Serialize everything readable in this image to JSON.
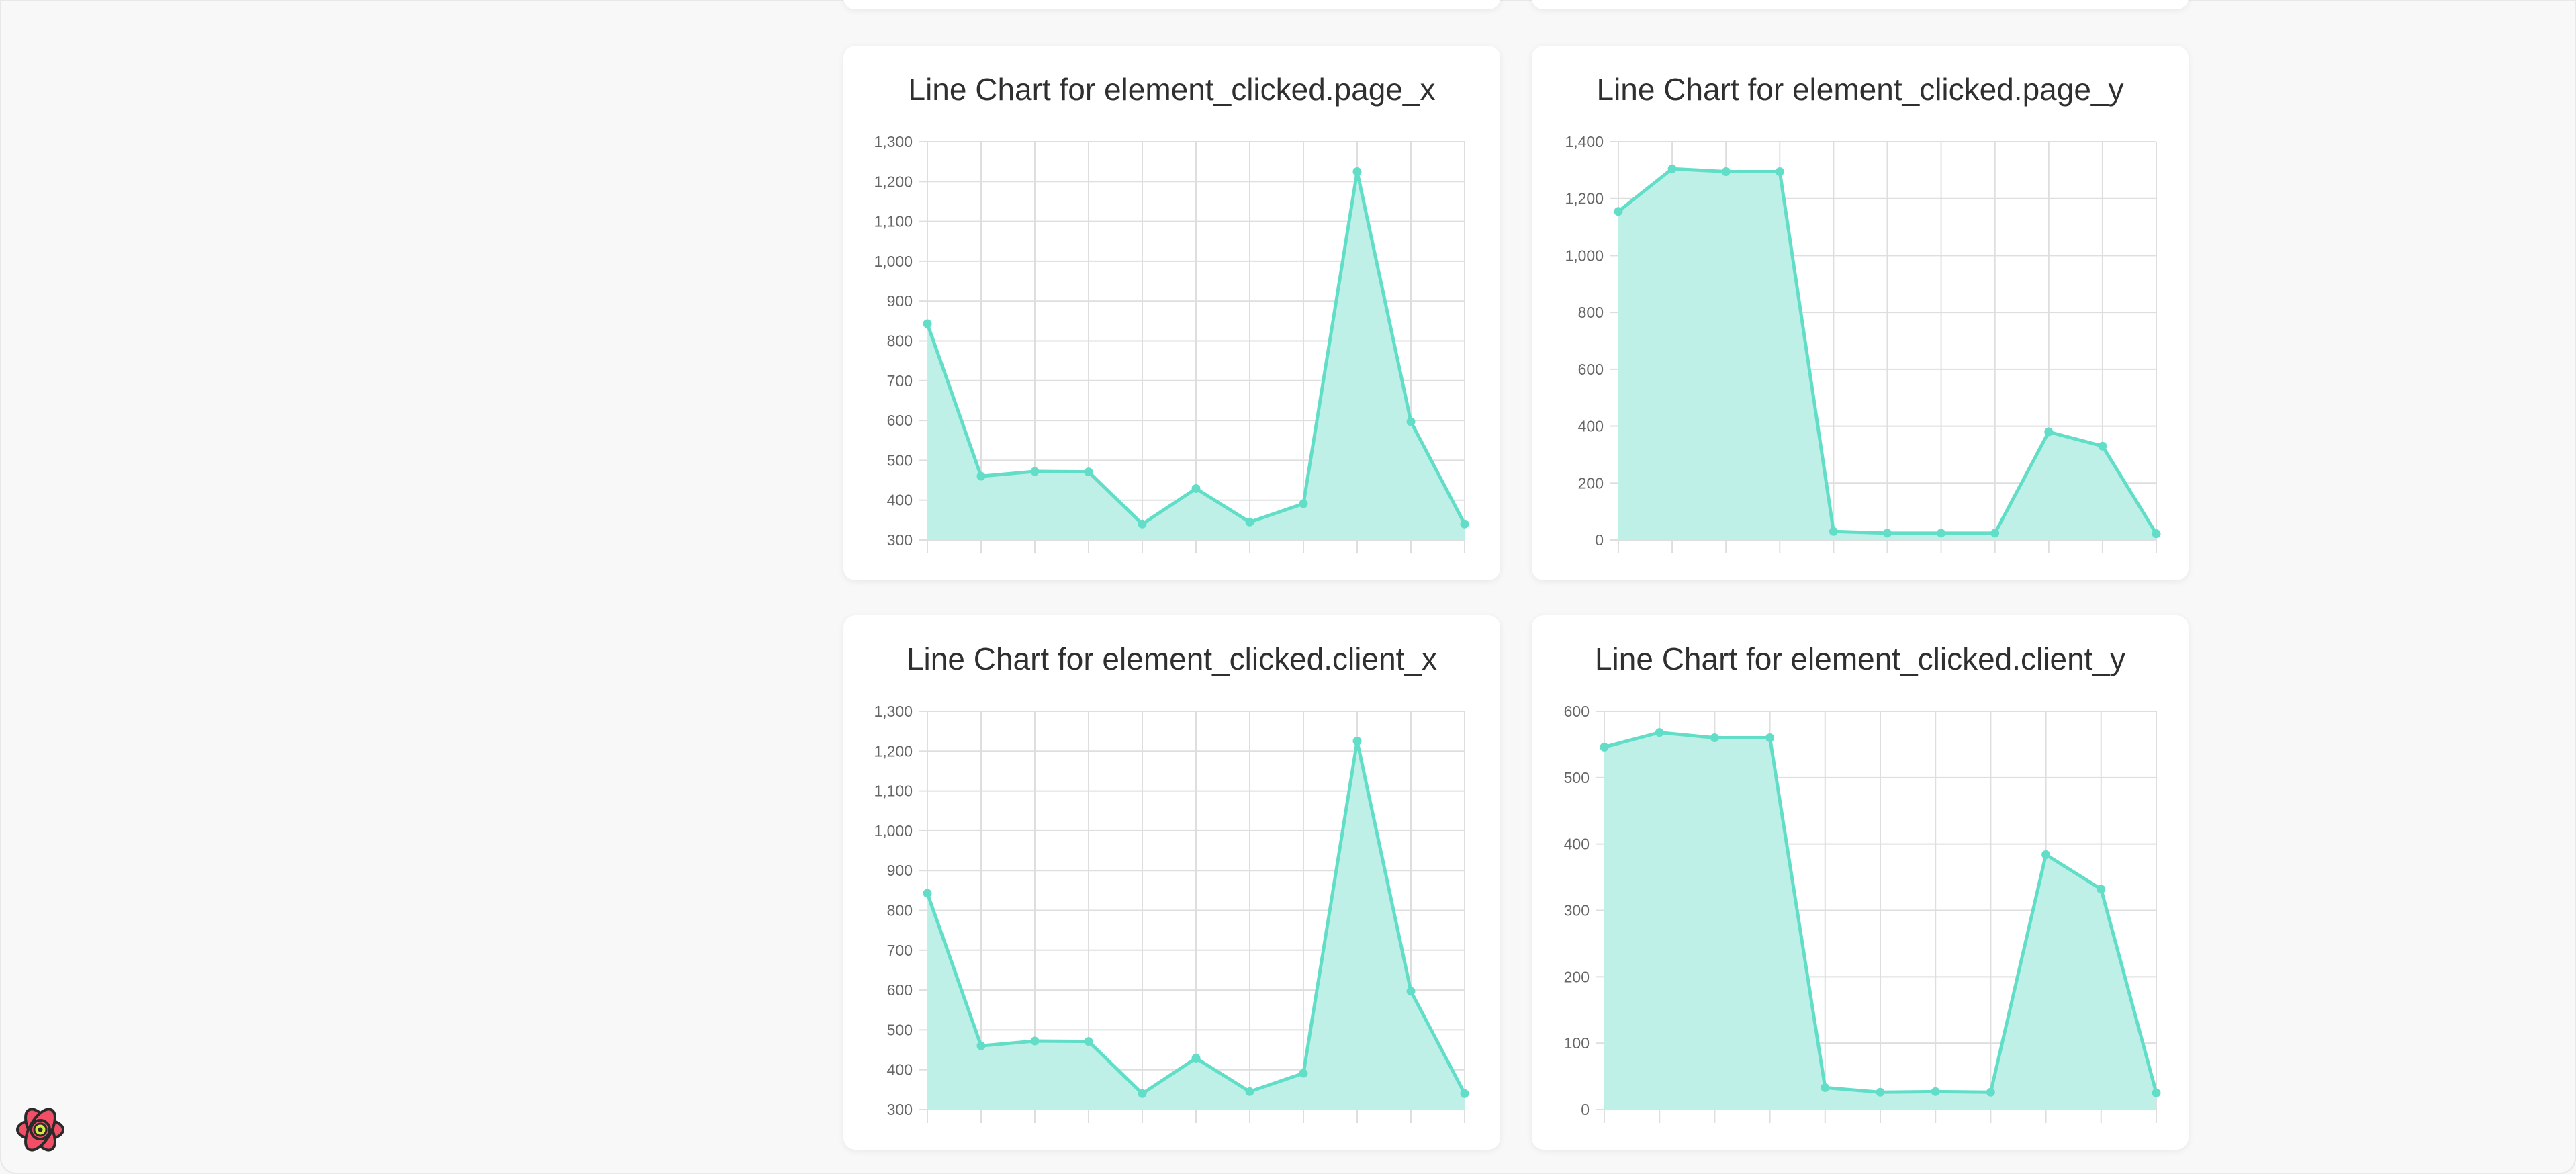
{
  "colors": {
    "page_background": "#f8f8f8",
    "card_background": "#ffffff",
    "series_line": "#62dec8",
    "series_fill": "#bdf0e7",
    "grid": "#dedede",
    "tick_text": "#666666",
    "title_text": "#2f2f2f",
    "react_logo": "#f24f66"
  },
  "icons": {
    "dev_tools": "react-logo-icon"
  },
  "chart_data": [
    {
      "type": "area",
      "title": "Line Chart for element_clicked.page_x",
      "y_ticks": [
        "1,300",
        "1,200",
        "1,100",
        "1,000",
        "900",
        "800",
        "700",
        "600",
        "500",
        "400",
        "300"
      ],
      "ylim": [
        300,
        1300
      ],
      "grid": true,
      "x_points": 11,
      "values": [
        843,
        460,
        472,
        471,
        340,
        429,
        345,
        391,
        1225,
        597,
        340
      ]
    },
    {
      "type": "area",
      "title": "Line Chart for element_clicked.page_y",
      "y_ticks": [
        "1,400",
        "1,200",
        "1,000",
        "800",
        "600",
        "400",
        "200",
        "0"
      ],
      "ylim": [
        0,
        1400
      ],
      "grid": true,
      "x_points": 11,
      "values": [
        1155,
        1305,
        1295,
        1295,
        30,
        24,
        24,
        24,
        380,
        330,
        22
      ]
    },
    {
      "type": "area",
      "title": "Line Chart for element_clicked.client_x",
      "y_ticks": [
        "1,300",
        "1,200",
        "1,100",
        "1,000",
        "900",
        "800",
        "700",
        "600",
        "500",
        "400",
        "300"
      ],
      "ylim": [
        300,
        1300
      ],
      "grid": true,
      "x_points": 11,
      "values": [
        843,
        460,
        472,
        471,
        340,
        429,
        345,
        391,
        1225,
        597,
        340
      ]
    },
    {
      "type": "area",
      "title": "Line Chart for element_clicked.client_y",
      "y_ticks": [
        "600",
        "500",
        "400",
        "300",
        "200",
        "100",
        "0"
      ],
      "ylim": [
        0,
        600
      ],
      "grid": true,
      "x_points": 11,
      "values": [
        546,
        568,
        560,
        560,
        33,
        26,
        27,
        26,
        384,
        332,
        25
      ]
    }
  ]
}
